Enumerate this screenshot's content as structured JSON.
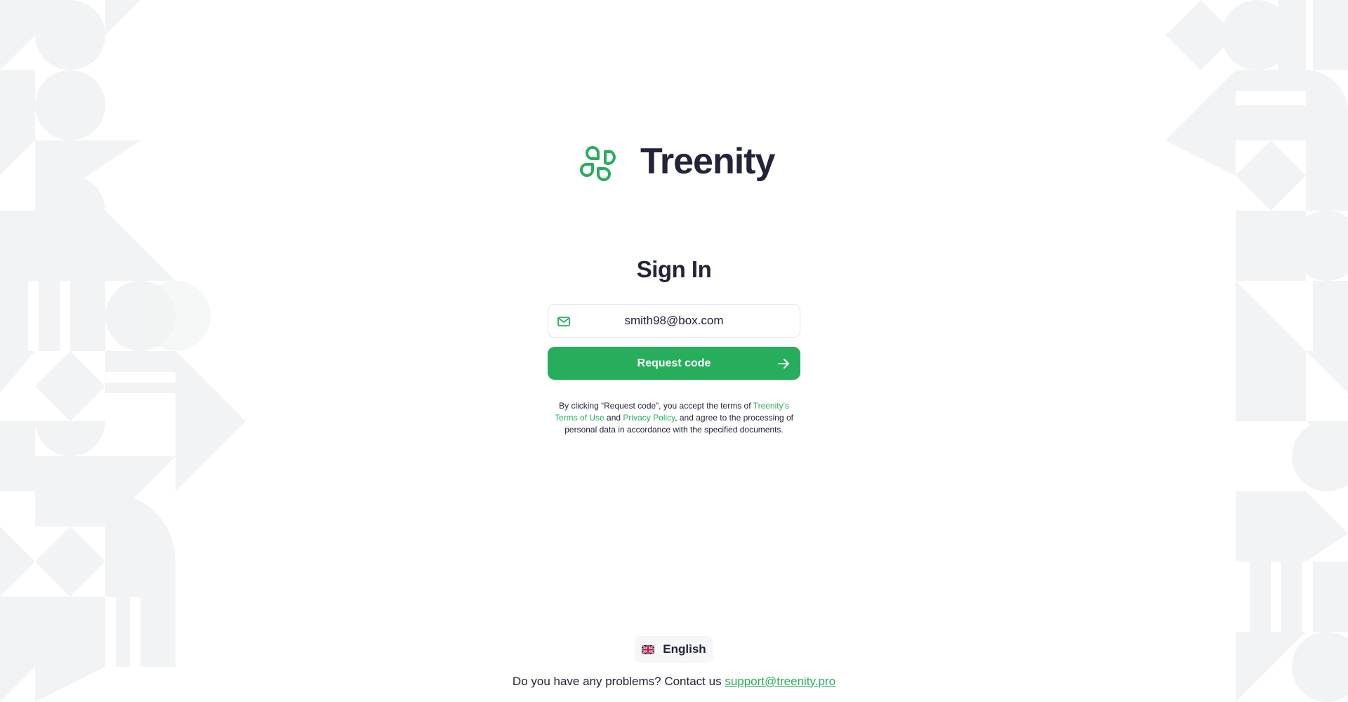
{
  "brand": {
    "name": "Treenity",
    "accent_color": "#27ae5c",
    "logo_icon": "leaf-cluster-icon"
  },
  "signin": {
    "title": "Sign In",
    "email_value": "smith98@box.com",
    "email_icon": "mail-icon",
    "submit_label": "Request code",
    "submit_icon": "arrow-right-icon"
  },
  "terms": {
    "prefix": "By clicking “Request code”, you accept the terms of ",
    "terms_link": "Treenity's Terms of Use",
    "and": " and ",
    "privacy_link": "Privacy Policy",
    "suffix": ", and agree to the processing of personal data in accordance with the specified documents."
  },
  "language": {
    "label": "English",
    "flag_icon": "uk-flag-icon"
  },
  "footer": {
    "text": "Do you have any problems? Contact us ",
    "email": "support@treenity.pro"
  }
}
